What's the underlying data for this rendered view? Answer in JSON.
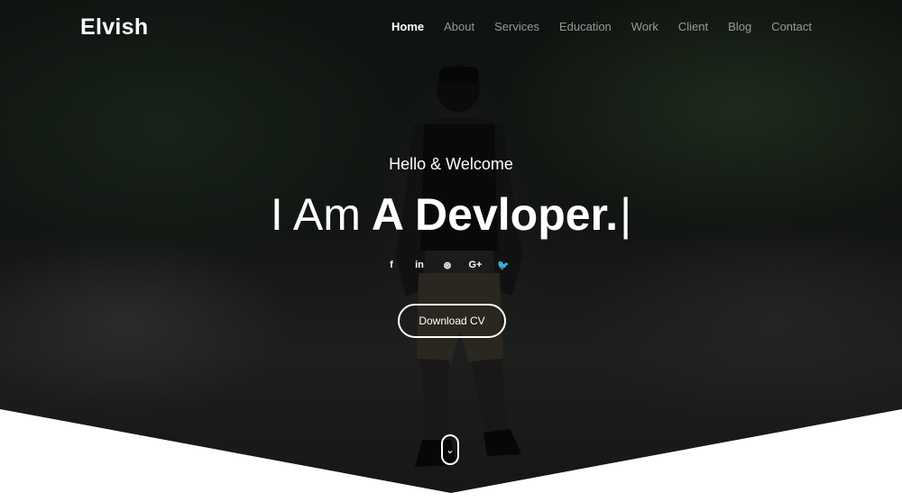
{
  "brand": {
    "logo": "Elvish"
  },
  "nav": {
    "items": [
      "Home",
      "About",
      "Services",
      "Education",
      "Work",
      "Client",
      "Blog",
      "Contact"
    ]
  },
  "hero": {
    "greeting": "Hello & Welcome",
    "headline_prefix": "I Am",
    "headline_bold": "A Devloper.",
    "cursor": "|",
    "cta_label": "Download CV"
  },
  "social": {
    "icons": [
      "facebook-icon",
      "linkedin-icon",
      "dribbble-icon",
      "google-plus-icon",
      "twitter-icon"
    ],
    "glyphs": [
      "f",
      "in",
      "⊛",
      "G+",
      "🐦"
    ]
  },
  "scroll_indicator": {
    "glyph": "⌄"
  },
  "colors": {
    "text": "#ffffff",
    "nav_inactive": "rgba(255,255,255,0.55)",
    "bottom_band": "#ffffff"
  }
}
